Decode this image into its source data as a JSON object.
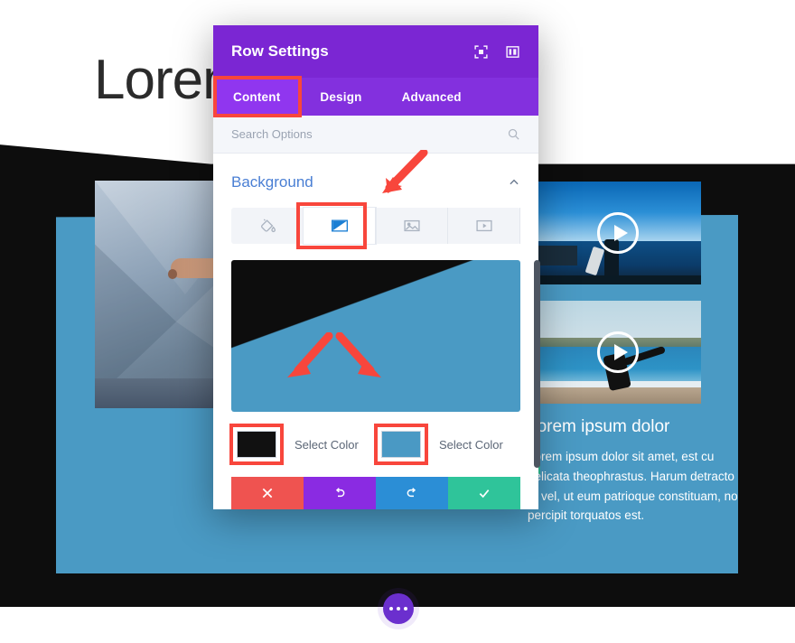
{
  "page": {
    "hero_title": "Lorem",
    "right_column": {
      "heading": "Lorem ipsum dolor",
      "body": "Lorem ipsum dolor sit amet, est cu delicata theophrastus. Harum detracto et vel, ut eum patrioque constituam, no percipit torquatos est."
    },
    "fab": {
      "name": "page-settings-button",
      "icon": "ellipsis-icon"
    },
    "colors": {
      "blue_block": "#4a9ac4",
      "black_section": "#0d0d0d",
      "teal_chip": "#31c49a",
      "fab": "#6b2fce"
    },
    "thumbnails": [
      {
        "name": "video-thumbnail-1",
        "play_icon": "play-icon"
      },
      {
        "name": "video-thumbnail-2",
        "play_icon": "play-icon"
      }
    ]
  },
  "modal": {
    "title": "Row Settings",
    "header_icons": [
      {
        "name": "fullscreen-icon",
        "label": "Expand"
      },
      {
        "name": "layout-icon",
        "label": "Layout"
      }
    ],
    "tabs": [
      {
        "label": "Content",
        "active": true
      },
      {
        "label": "Design",
        "active": false
      },
      {
        "label": "Advanced",
        "active": false
      }
    ],
    "search": {
      "placeholder": "Search Options",
      "icon": "search-icon"
    },
    "section": {
      "title": "Background",
      "collapse_icon": "chevron-up-icon",
      "bg_types": [
        {
          "name": "background-color-tab",
          "icon": "paint-bucket-icon",
          "active": false
        },
        {
          "name": "background-gradient-tab",
          "icon": "gradient-icon",
          "active": true
        },
        {
          "name": "background-image-tab",
          "icon": "image-icon",
          "active": false
        },
        {
          "name": "background-video-tab",
          "icon": "video-icon",
          "active": false
        }
      ],
      "gradient_preview": {
        "start_color": "#0d0d0d",
        "end_color": "#4a9ac4",
        "direction": "160deg"
      },
      "color_stops": [
        {
          "name": "gradient-color-1",
          "color": "#111111",
          "label": "Select Color"
        },
        {
          "name": "gradient-color-2",
          "color": "#4a99c4",
          "label": "Select Color"
        }
      ]
    },
    "actions": [
      {
        "name": "cancel-button",
        "icon": "close-icon",
        "color": "#ef5350"
      },
      {
        "name": "undo-button",
        "icon": "undo-icon",
        "color": "#8a2be2"
      },
      {
        "name": "redo-button",
        "icon": "redo-icon",
        "color": "#2b8ed6"
      },
      {
        "name": "save-button",
        "icon": "check-icon",
        "color": "#2fc49a"
      }
    ],
    "highlight_color": "#f8463c"
  },
  "annotations": {
    "arrow_to_gradient_tab": "arrow-icon",
    "arrow_to_color_1": "arrow-icon",
    "arrow_to_color_2": "arrow-icon"
  }
}
